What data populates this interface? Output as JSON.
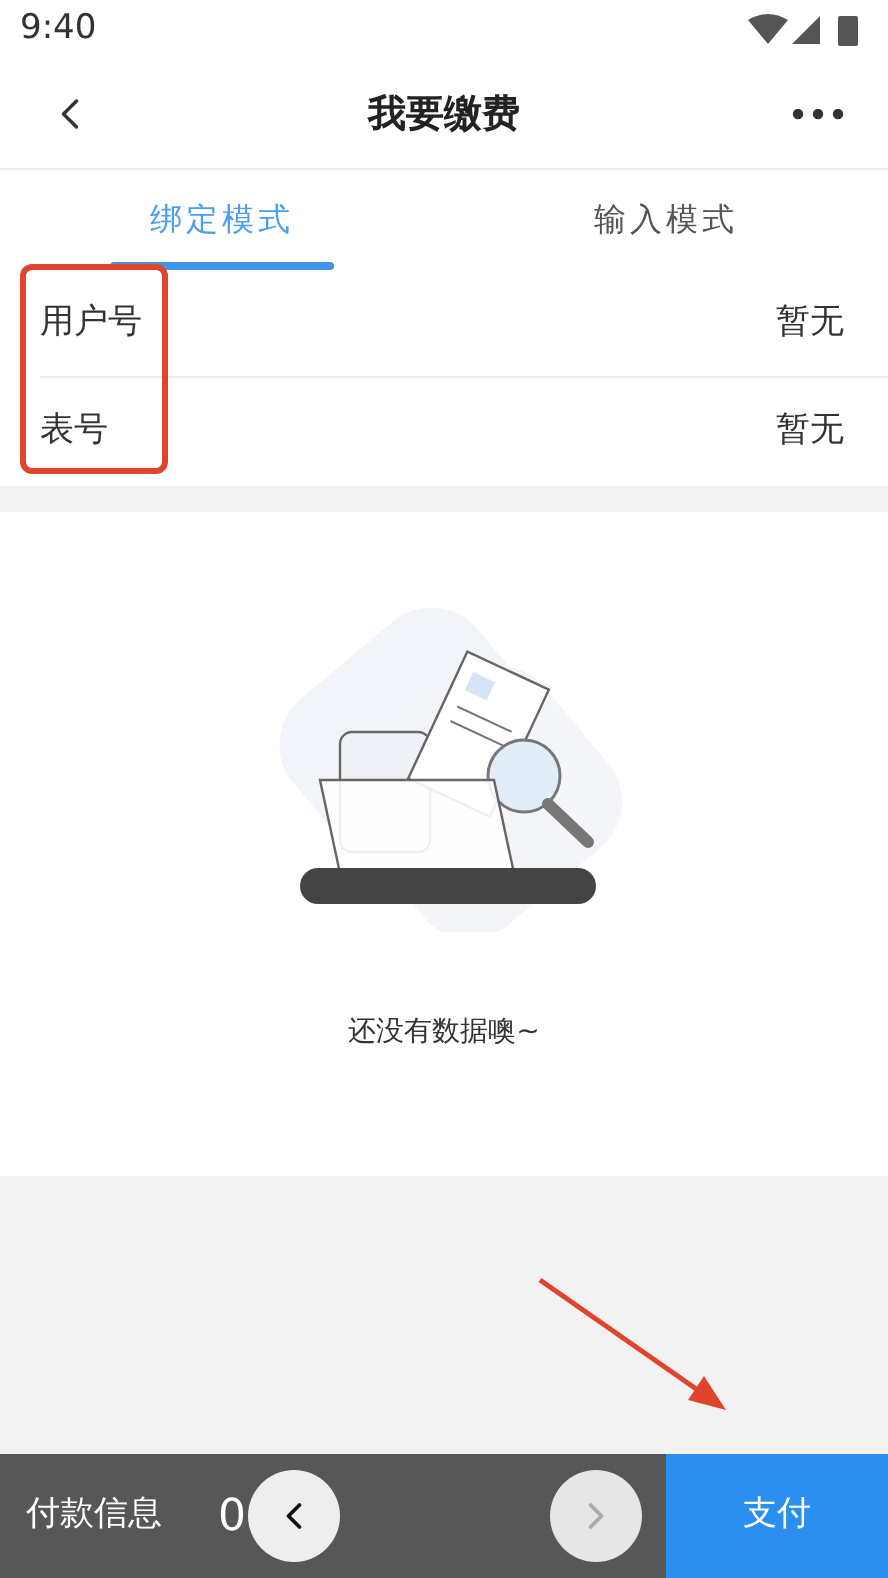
{
  "status_bar": {
    "time": "9:40"
  },
  "header": {
    "title": "我要缴费"
  },
  "tabs": [
    {
      "label": "绑定模式",
      "selected": true
    },
    {
      "label": "输入模式",
      "selected": false
    }
  ],
  "rows": [
    {
      "label": "用户号",
      "value": "暂无"
    },
    {
      "label": "表号",
      "value": "暂无"
    }
  ],
  "empty_state": {
    "message": "还没有数据噢~"
  },
  "bottom_bar": {
    "label": "付款信息",
    "amount": "0",
    "pay_button": "支付"
  },
  "carousel_buttons": [
    {
      "kind": "prev",
      "disabled": false
    },
    {
      "kind": "next",
      "disabled": true
    }
  ]
}
